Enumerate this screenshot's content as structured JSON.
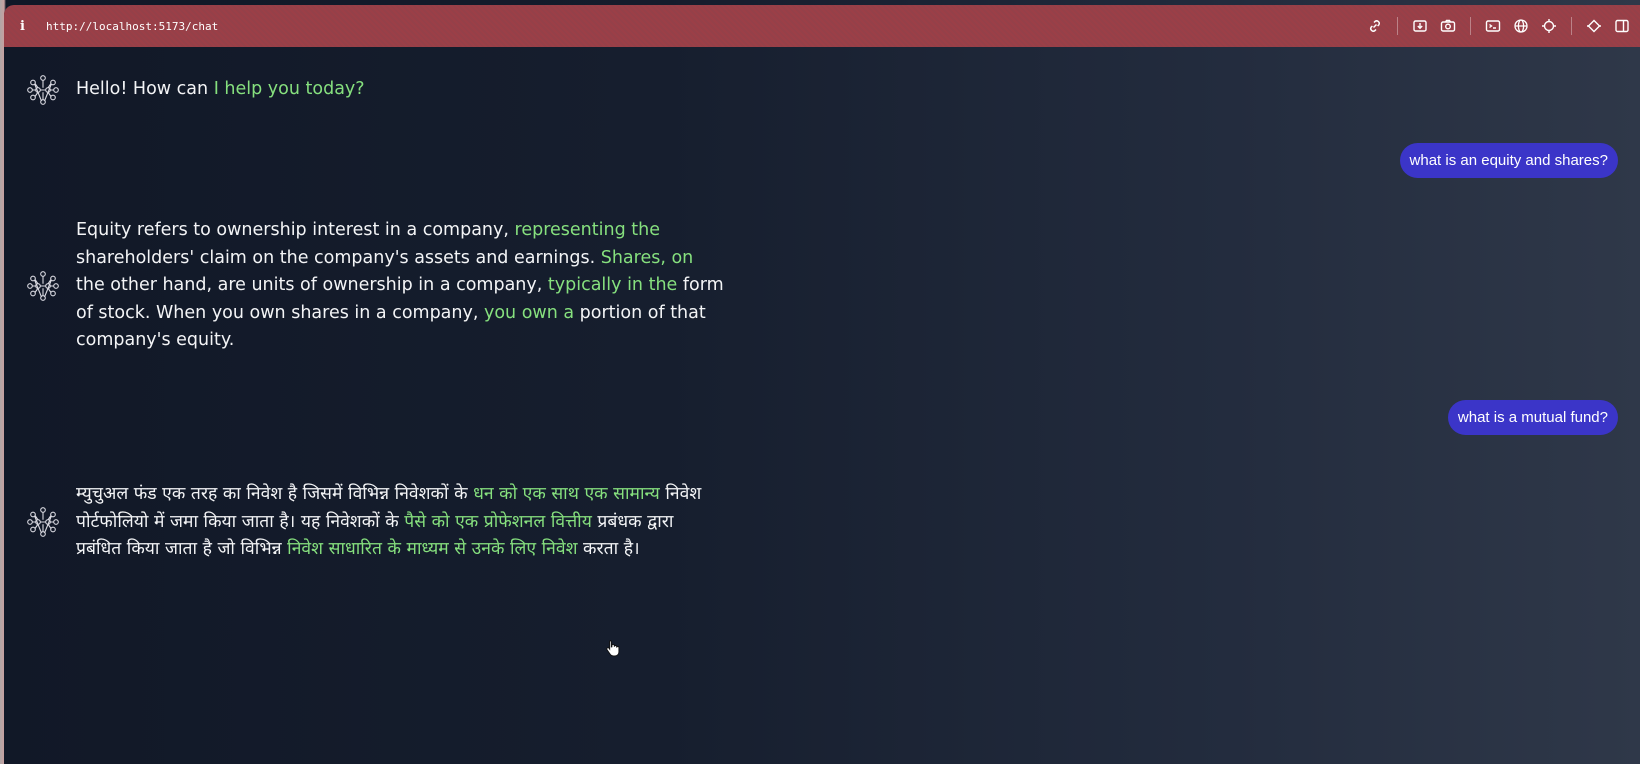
{
  "browser": {
    "info_icon": "i",
    "url": "http://localhost:5173/chat",
    "tools": [
      "link-icon",
      "download-icon",
      "camera-icon",
      "terminal-icon",
      "globe-icon",
      "crosshair-icon",
      "extension-icon",
      "sidebar-icon"
    ]
  },
  "messages": {
    "bot1": {
      "part1": "Hello! How can ",
      "part2": "I help you today?"
    },
    "user1": "what is an equity and shares?",
    "bot2": {
      "part1": "Equity refers to ownership interest in a company, ",
      "part2": "representing the",
      "part3": " shareholders' claim on the company's assets and earnings. ",
      "part4": "Shares, on",
      "part5": " the other hand, are units of ownership in a company, ",
      "part6": "typically in the",
      "part7": " form of stock. When you own shares in a company, ",
      "part8": "you own a",
      "part9": " portion of that company's equity."
    },
    "user2": "what is a mutual fund?",
    "bot3": {
      "part1": "म्युचुअल फंड एक तरह का निवेश है जिसमें विभिन्न निवेशकों के ",
      "part2": "धन को एक साथ एक सामान्य",
      "part3": " निवेश पोर्टफोलियो में जमा किया जाता है। यह निवेशकों के ",
      "part4": "पैसे को एक प्रोफेशनल वित्तीय",
      "part5": " प्रबंधक द्वारा प्रबंधित किया जाता है जो विभिन्न ",
      "part6": "निवेश साधारित के माध्यम से उनके लिए निवेश",
      "part7": " करता है।"
    }
  },
  "colors": {
    "accent": "#3b35c8",
    "highlight": "#86e07e",
    "topbar": "#9b3f47"
  }
}
